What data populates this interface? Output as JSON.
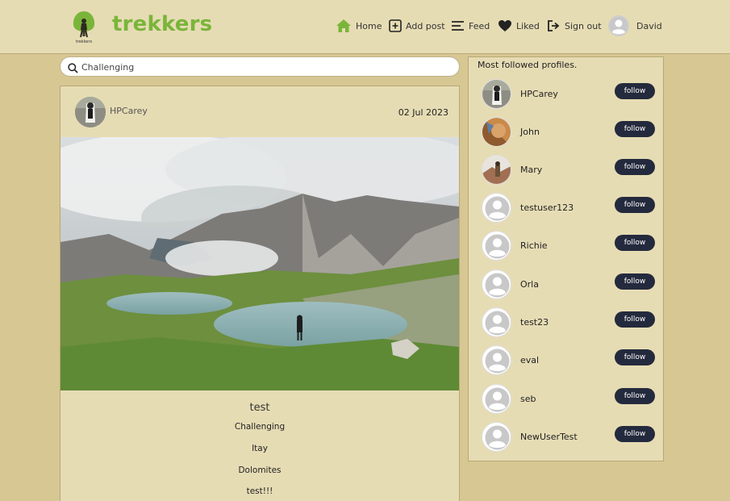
{
  "brand": {
    "name": "trekkers",
    "small": "trekkers",
    "color": "#7ab53a"
  },
  "nav": {
    "home": "Home",
    "add_post": "Add post",
    "feed": "Feed",
    "liked": "Liked",
    "sign_out": "Sign out",
    "user": "David"
  },
  "search": {
    "value": "Challenging"
  },
  "post": {
    "author": "HPCarey",
    "date": "02 Jul 2023",
    "title": "test",
    "lines": [
      "Challenging",
      "Itay",
      "Dolomites",
      "test!!!"
    ]
  },
  "sidebar": {
    "title": "Most followed profiles.",
    "follow_label": "follow",
    "profiles": [
      {
        "name": "HPCarey",
        "avatar": "photo-hiker"
      },
      {
        "name": "John",
        "avatar": "photo-orange"
      },
      {
        "name": "Mary",
        "avatar": "photo-mountain"
      },
      {
        "name": "testuser123",
        "avatar": "default-avatar"
      },
      {
        "name": "Richie",
        "avatar": "default-avatar"
      },
      {
        "name": "Orla",
        "avatar": "default-avatar"
      },
      {
        "name": "test23",
        "avatar": "default-avatar"
      },
      {
        "name": "eval",
        "avatar": "default-avatar"
      },
      {
        "name": "seb",
        "avatar": "default-avatar"
      },
      {
        "name": "NewUserTest",
        "avatar": "default-avatar"
      }
    ]
  },
  "colors": {
    "page_bg": "#d6c793",
    "panel_bg": "#e6dcb4",
    "button_bg": "#242a3d",
    "brand_green": "#7ab53a"
  }
}
